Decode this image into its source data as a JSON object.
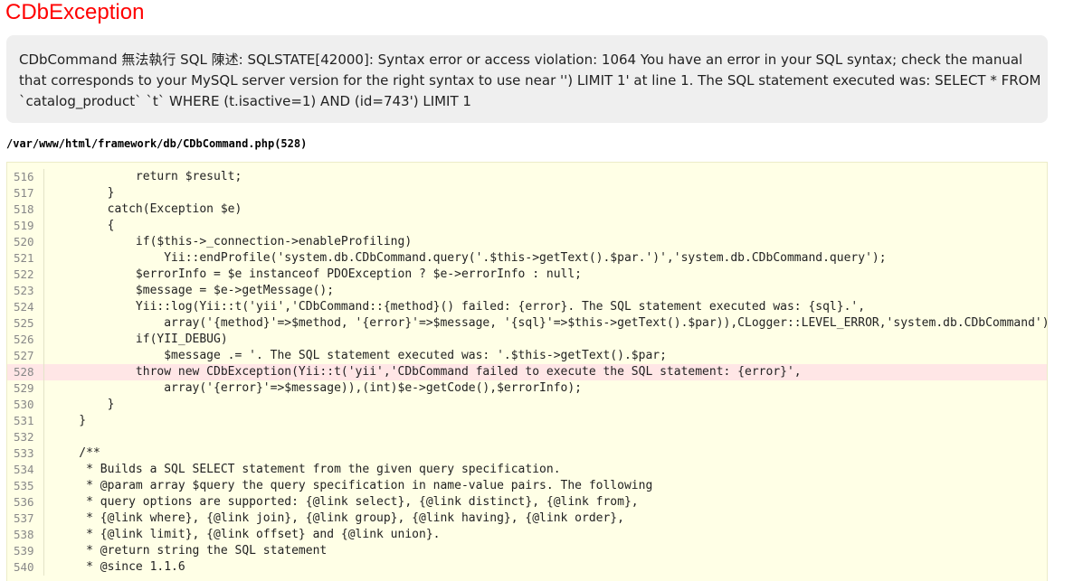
{
  "error": {
    "title": "CDbException",
    "message_lines": [
      "CDbCommand 無法執行 SQL 陳述: SQLSTATE[42000]: Syntax error or access violation: 1064 You have an error in your SQL syntax; check the manual",
      "that corresponds to your MySQL server version for the right syntax to use near '') LIMIT 1' at line 1. The SQL statement executed was: SELECT * FROM",
      "`catalog_product` `t` WHERE (t.isactive=1) AND (id=743') LIMIT 1"
    ],
    "source_file": "/var/www/html/framework/db/CDbCommand.php(528)"
  },
  "code": {
    "highlighted_line": "528",
    "lines": [
      {
        "num": "516",
        "text": "            return $result;"
      },
      {
        "num": "517",
        "text": "        }"
      },
      {
        "num": "518",
        "text": "        catch(Exception $e)"
      },
      {
        "num": "519",
        "text": "        {"
      },
      {
        "num": "520",
        "text": "            if($this->_connection->enableProfiling)"
      },
      {
        "num": "521",
        "text": "                Yii::endProfile('system.db.CDbCommand.query('.$this->getText().$par.')','system.db.CDbCommand.query');"
      },
      {
        "num": "522",
        "text": "            $errorInfo = $e instanceof PDOException ? $e->errorInfo : null;"
      },
      {
        "num": "523",
        "text": "            $message = $e->getMessage();"
      },
      {
        "num": "524",
        "text": "            Yii::log(Yii::t('yii','CDbCommand::{method}() failed: {error}. The SQL statement executed was: {sql}.',"
      },
      {
        "num": "525",
        "text": "                array('{method}'=>$method, '{error}'=>$message, '{sql}'=>$this->getText().$par)),CLogger::LEVEL_ERROR,'system.db.CDbCommand');"
      },
      {
        "num": "526",
        "text": "            if(YII_DEBUG)"
      },
      {
        "num": "527",
        "text": "                $message .= '. The SQL statement executed was: '.$this->getText().$par;"
      },
      {
        "num": "528",
        "text": "            throw new CDbException(Yii::t('yii','CDbCommand failed to execute the SQL statement: {error}',"
      },
      {
        "num": "529",
        "text": "                array('{error}'=>$message)),(int)$e->getCode(),$errorInfo);"
      },
      {
        "num": "530",
        "text": "        }"
      },
      {
        "num": "531",
        "text": "    }"
      },
      {
        "num": "532",
        "text": ""
      },
      {
        "num": "533",
        "text": "    /**"
      },
      {
        "num": "534",
        "text": "     * Builds a SQL SELECT statement from the given query specification."
      },
      {
        "num": "535",
        "text": "     * @param array $query the query specification in name-value pairs. The following"
      },
      {
        "num": "536",
        "text": "     * query options are supported: {@link select}, {@link distinct}, {@link from},"
      },
      {
        "num": "537",
        "text": "     * {@link where}, {@link join}, {@link group}, {@link having}, {@link order},"
      },
      {
        "num": "538",
        "text": "     * {@link limit}, {@link offset} and {@link union}."
      },
      {
        "num": "539",
        "text": "     * @return string the SQL statement"
      },
      {
        "num": "540",
        "text": "     * @since 1.1.6"
      }
    ]
  },
  "colors": {
    "title": "#ff0000",
    "message_background": "#efefef",
    "code_background": "#ffffe6",
    "highlight_background": "#ffe6e6"
  }
}
